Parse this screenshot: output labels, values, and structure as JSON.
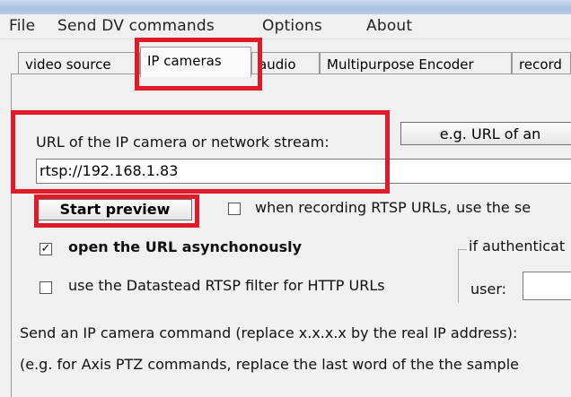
{
  "menubar": {
    "items": [
      "File",
      "Send DV commands",
      "Options",
      "About"
    ]
  },
  "tabs": [
    "video source",
    "IP cameras",
    "audio",
    "Multipurpose Encoder",
    "record"
  ],
  "url_section": {
    "label": "URL of the IP camera or network stream:",
    "example_button": "e.g. URL of an",
    "url_value": "rtsp://192.168.1.83"
  },
  "preview": {
    "start_button": "Start preview",
    "rtsp_record_checkbox_label": "when recording RTSP URLs, use the se",
    "rtsp_record_checked": false
  },
  "options": {
    "async_label": "open the URL asynchonously",
    "async_checked": true,
    "async_check_mark": "✓",
    "datastead_label": "use the Datastead RTSP filter for HTTP URLs",
    "datastead_checked": false
  },
  "auth": {
    "group_label": "if authenticat",
    "user_label": "user:",
    "user_value": ""
  },
  "commands": {
    "line1": "Send an IP camera command (replace x.x.x.x by the real IP address):",
    "line2": "(e.g. for Axis PTZ commands, replace the last word of the the sample"
  },
  "highlight_color": "#e01a26"
}
